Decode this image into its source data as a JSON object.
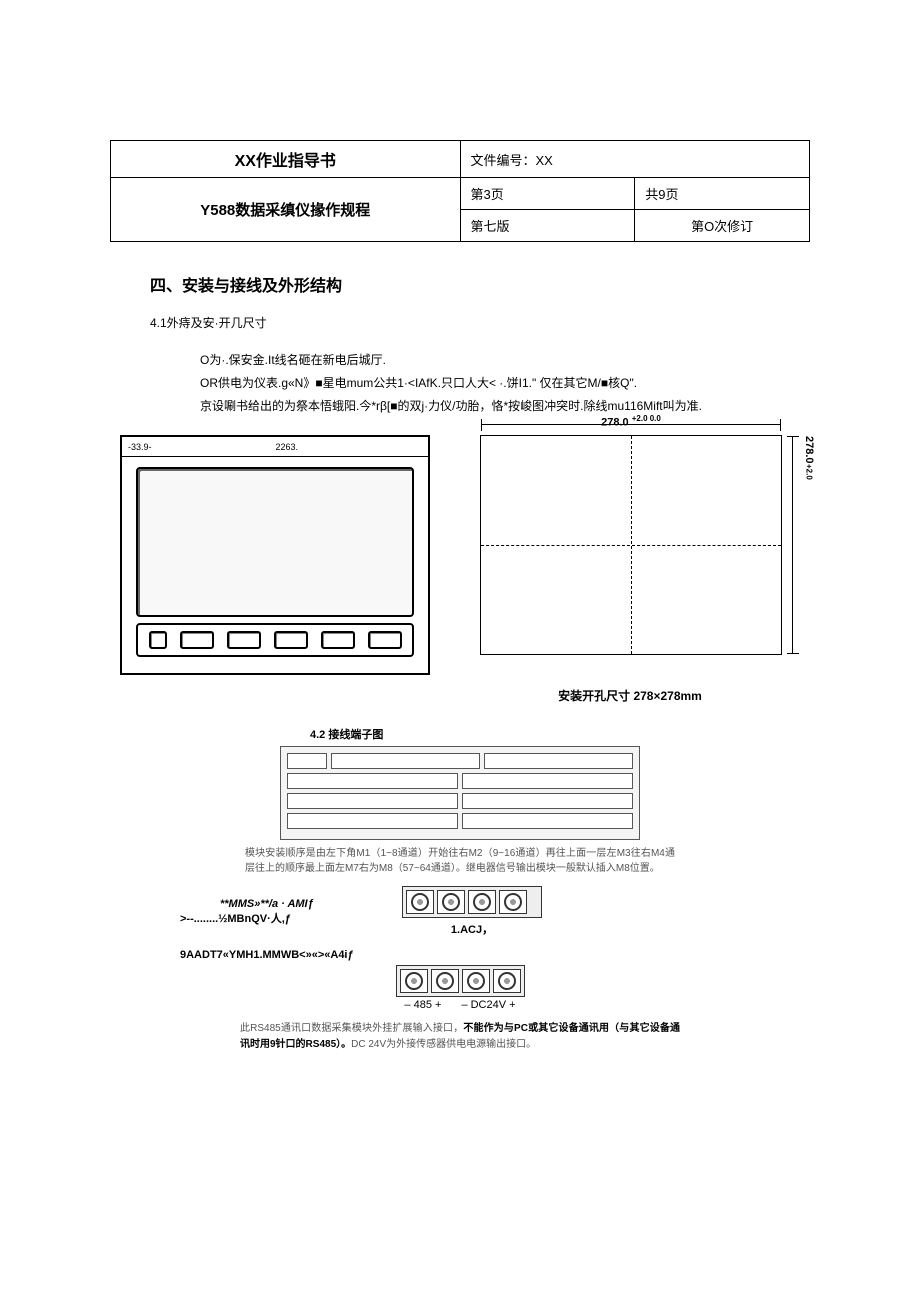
{
  "header": {
    "left_top": "XX作业指导书",
    "left_bottom": "Y588数据采缜仪掾作规程",
    "doc_no_label": "文件编号：XX",
    "page_cur": "第3页",
    "page_total": "共9页",
    "edition": "第七版",
    "revision": "第O次修订"
  },
  "section": {
    "title": "四、安装与接线及外形结构",
    "subtitle": "4.1外痔及安·开几尺寸",
    "body_l1": "O为·.保安金.It线名砸在新电后城厅.",
    "body_l2": "OR供电为仪表.g«N》■星电mum公共1·<IAfK.只口人大< ·.饼I1.\" 仅在其它M/■核Q\".",
    "body_l3": "京设唰书给出的为祭本悟蛾阳.今*rβ[■的双j·力仪/功胎，恪*按峻图冲突时.除线mu116Mift叫为准."
  },
  "device": {
    "top_left": "-33.9-",
    "top_mid": "2263."
  },
  "cutout": {
    "width_dim": "278.0",
    "width_tol": "+2.0 0.0",
    "height_dim": "278.0",
    "height_tol": "+2.0",
    "caption": "安装开孔尺寸 278×278mm"
  },
  "terminal": {
    "title": "4.2 接线端子图",
    "note1": "模块安装顺序是由左下角M1（1~8通道）开始往右M2（9~16通道）再往上面一层左M3往右M4通层往上的顺序最上面左M7右为M8（57~64通道）。继电器信号输出模块一般默认插入M8位置。"
  },
  "conn": {
    "l1": "**MMS»**/a · AMIƒ",
    "l2": ">--........½MBnQV·人,ƒ",
    "acj": "1.ACJ，",
    "title2": "9AADT7«YMH1.MMWB<»«>«A4iƒ",
    "bl1": "– 485 +",
    "bl2": "– DC24V +",
    "final1": "此RS485通讯口数据采集模块外挂扩展输入接口，",
    "final_bold": "不能作为与PC或其它设备通讯用（与其它设备通讯时用9针口的RS485）。",
    "final2": "DC 24V为外接传感器供电电源输出接口。"
  }
}
